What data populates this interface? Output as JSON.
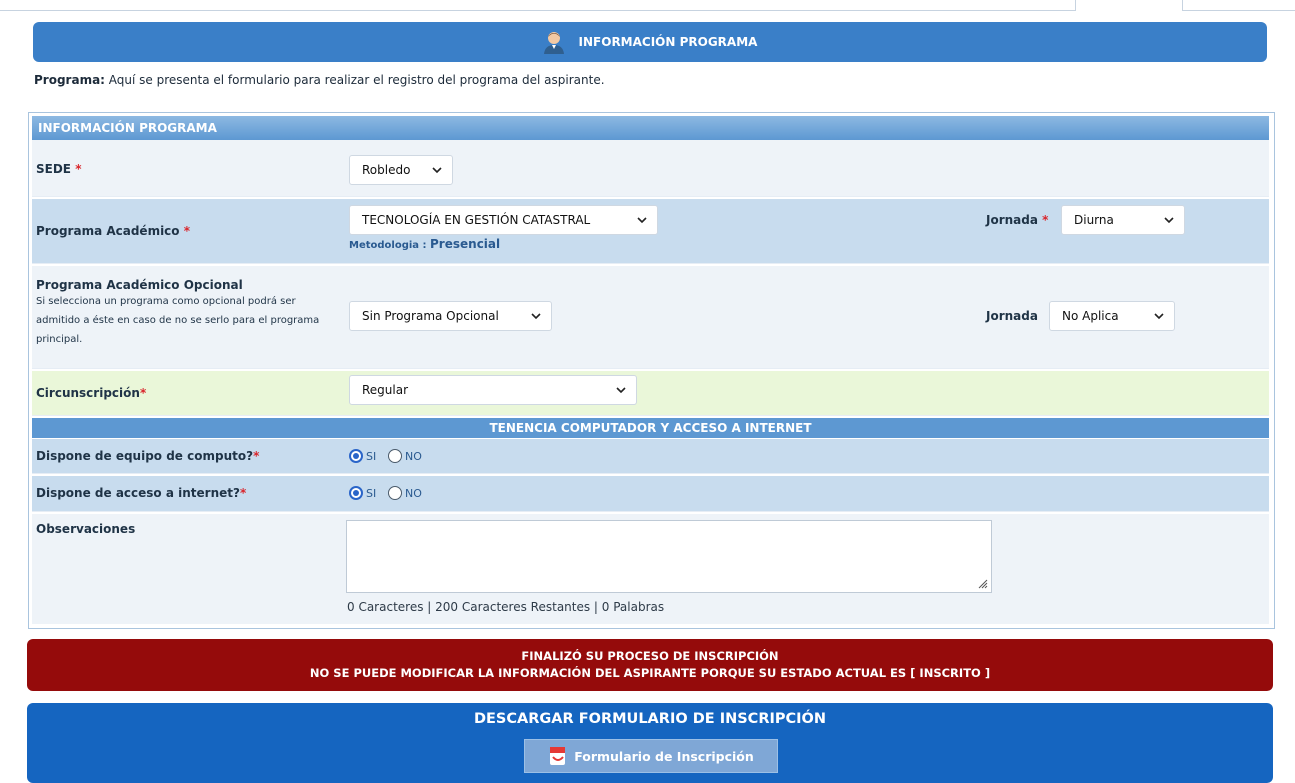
{
  "header": {
    "title": "INFORMACIÓN PROGRAMA"
  },
  "intro": {
    "label": "Programa:",
    "text": " Aquí se presenta el formulario para realizar el registro del programa del aspirante."
  },
  "section": {
    "title": "INFORMACIÓN PROGRAMA"
  },
  "sede": {
    "label": "SEDE",
    "required": "*",
    "value": "Robledo"
  },
  "programa": {
    "label": "Programa Académico",
    "required": "*",
    "value": "TECNOLOGÍA EN GESTIÓN CATASTRAL",
    "metodologia_label": "Metodologia : ",
    "metodologia_value": "Presencial",
    "jornada_label": "Jornada",
    "jornada_required": "*",
    "jornada_value": "Diurna"
  },
  "opcional": {
    "label": "Programa Académico Opcional",
    "help": "Si selecciona un programa como opcional podrá ser admitido a éste en caso de no se serlo para el programa principal.",
    "value": "Sin Programa Opcional",
    "jornada_label": "Jornada",
    "jornada_value": "No Aplica"
  },
  "circunscripcion": {
    "label": "Circunscripción",
    "required": "*",
    "value": "Regular"
  },
  "tenencia": {
    "title": "TENENCIA COMPUTADOR Y ACCESO A INTERNET"
  },
  "equipo": {
    "label": "Dispone de equipo de computo?",
    "required": "*",
    "yes": "SI",
    "no": "NO",
    "selected": "SI"
  },
  "internet": {
    "label": "Dispone de acceso a internet?",
    "required": "*",
    "yes": "SI",
    "no": "NO",
    "selected": "SI"
  },
  "observaciones": {
    "label": "Observaciones",
    "value": "",
    "counter": "0 Caracteres | 200 Caracteres Restantes | 0 Palabras"
  },
  "alert": {
    "line1": "FINALIZÓ SU PROCESO DE INSCRIPCIÓN",
    "line2": "NO SE PUEDE MODIFICAR LA INFORMACIÓN DEL ASPIRANTE PORQUE SU ESTADO ACTUAL ES [ INSCRITO ]"
  },
  "download": {
    "title": "DESCARGAR FORMULARIO DE INSCRIPCIÓN",
    "button": "Formulario de Inscripción"
  },
  "colors": {
    "header": "#3a7fc8",
    "alert": "#950b0b",
    "download": "#1565c0",
    "required": "#d9262c"
  }
}
